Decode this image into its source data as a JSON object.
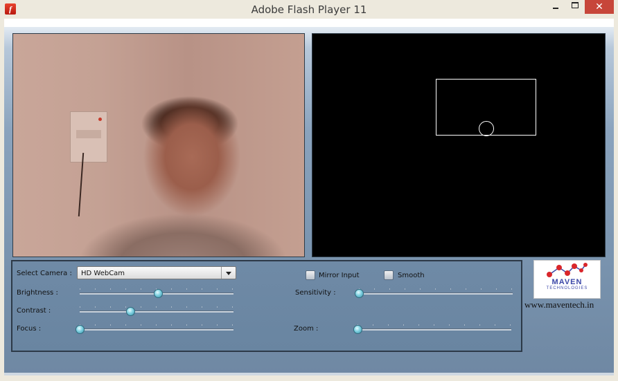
{
  "window": {
    "title": "Adobe Flash Player 11",
    "app_icon": "flash-icon",
    "close_glyph": "✕"
  },
  "controls": {
    "select_camera_label": "Select Camera :",
    "camera_value": "HD WebCam",
    "brightness_label": "Brightness :",
    "brightness_level": 0.51,
    "contrast_label": "Contrast :",
    "contrast_level": 0.33,
    "focus_label": "Focus :",
    "focus_level": 0,
    "mirror_label": "Mirror Input",
    "mirror_checked": false,
    "smooth_label": "Smooth",
    "smooth_checked": false,
    "sensitivity_label": "Sensitivity :",
    "sensitivity_level": 0,
    "zoom_label": "Zoom :",
    "zoom_level": 0
  },
  "branding": {
    "logo_text": "MAVEN",
    "logo_subtext": "TECHNOLOGIES",
    "website": "www.maventech.in",
    "logo_color": "#3b47a8",
    "logo_dot_color": "#d9262b"
  },
  "colors": {
    "close_button": "#c7463a",
    "panel": "#6f8aa6",
    "slider_thumb": "#7ed0e0"
  }
}
